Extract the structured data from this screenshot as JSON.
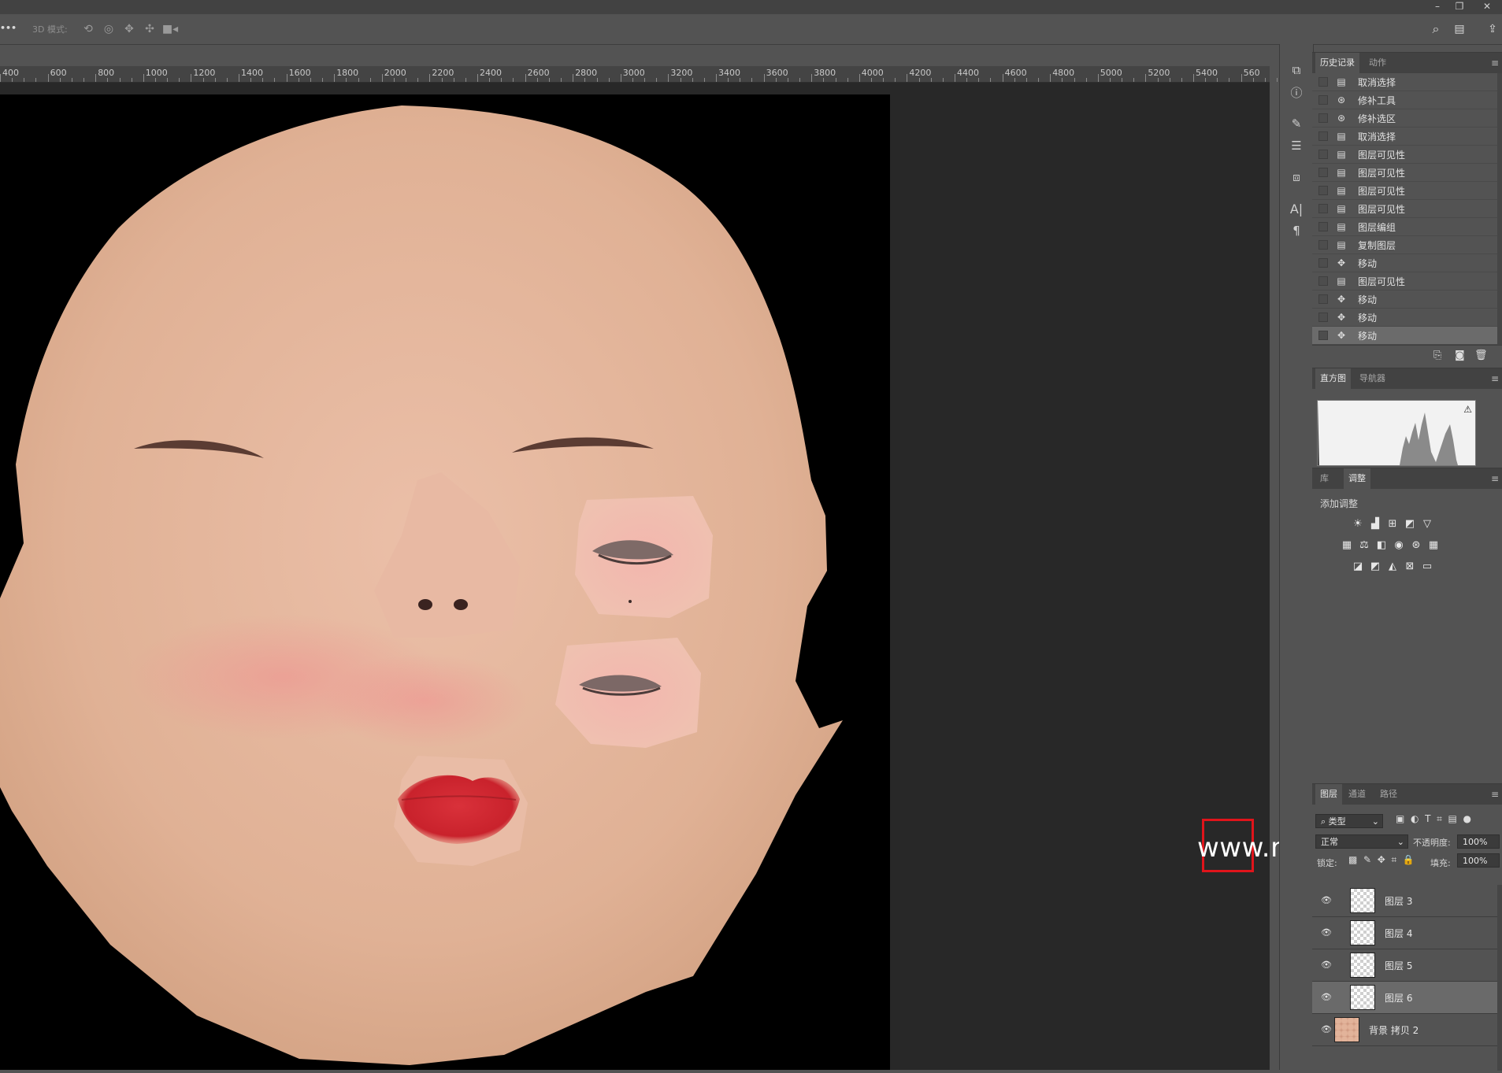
{
  "window": {
    "minimize": "–",
    "restore": "❐",
    "close": "✕"
  },
  "options_bar": {
    "more": "•••",
    "mode_label": "3D 模式:",
    "icons": [
      "rotate-3d-icon",
      "roll-3d-icon",
      "pan-3d-icon",
      "slide-3d-icon",
      "scale-3d-icon"
    ],
    "search_glyph": "⌕",
    "workspace_glyph": "▤",
    "share_glyph": "⇪"
  },
  "ruler": {
    "labels": [
      "400",
      "600",
      "800",
      "1000",
      "1200",
      "1400",
      "1600",
      "1800",
      "2000",
      "2200",
      "2400",
      "2600",
      "2800",
      "3000",
      "3200",
      "3400",
      "3600",
      "3800",
      "4000",
      "4200",
      "4400",
      "4600",
      "4800",
      "5000",
      "5200",
      "5400",
      "560"
    ]
  },
  "collapse_glyph": "‹‹",
  "history_panel": {
    "tabs": [
      "历史记录",
      "动作"
    ],
    "items": [
      {
        "icon": "document-icon",
        "label": "取消选择"
      },
      {
        "icon": "patch-tool-icon",
        "label": "修补工具"
      },
      {
        "icon": "patch-tool-icon",
        "label": "修补选区"
      },
      {
        "icon": "document-icon",
        "label": "取消选择"
      },
      {
        "icon": "document-icon",
        "label": "图层可见性"
      },
      {
        "icon": "document-icon",
        "label": "图层可见性"
      },
      {
        "icon": "document-icon",
        "label": "图层可见性"
      },
      {
        "icon": "document-icon",
        "label": "图层可见性"
      },
      {
        "icon": "document-icon",
        "label": "图层编组"
      },
      {
        "icon": "document-icon",
        "label": "复制图层"
      },
      {
        "icon": "move-icon",
        "label": "移动"
      },
      {
        "icon": "document-icon",
        "label": "图层可见性"
      },
      {
        "icon": "move-icon",
        "label": "移动"
      },
      {
        "icon": "move-icon",
        "label": "移动"
      },
      {
        "icon": "move-icon",
        "label": "移动"
      }
    ],
    "selected_index": 14
  },
  "histogram_panel": {
    "tabs": [
      "直方图",
      "导航器"
    ],
    "warning_glyph": "⚠"
  },
  "adjustments_panel": {
    "tabs": [
      "库",
      "调整"
    ],
    "add_label": "添加调整",
    "row1": [
      "brightness-icon",
      "levels-icon",
      "curves-icon",
      "exposure-icon",
      "vibrance-icon"
    ],
    "row2": [
      "hue-saturation-icon",
      "color-balance-icon",
      "black-white-icon",
      "photo-filter-icon",
      "channel-mixer-icon",
      "color-lookup-icon"
    ],
    "row3": [
      "invert-icon",
      "posterize-icon",
      "threshold-icon",
      "selective-color-icon",
      "gradient-map-icon"
    ]
  },
  "layers_panel": {
    "tabs": [
      "图层",
      "通道",
      "路径"
    ],
    "filter_label": "类型",
    "blend_mode": "正常",
    "opacity_label": "不透明度:",
    "opacity_value": "100%",
    "lock_label": "锁定:",
    "fill_label": "填充:",
    "fill_value": "100%",
    "layers": [
      {
        "name": "图层 3",
        "type": "transparent"
      },
      {
        "name": "图层 4",
        "type": "transparent"
      },
      {
        "name": "图层 5",
        "type": "transparent"
      },
      {
        "name": "图层 6",
        "type": "transparent"
      },
      {
        "name": "背景 拷贝 2",
        "type": "skin"
      }
    ],
    "selected_index": 3
  },
  "watermark": {
    "text": "www.metacosmic.cc"
  },
  "colors": {
    "skin": "#e2b39a",
    "lips": "#cf2b33",
    "panel_bg": "#535353",
    "accent_red": "#e0141b"
  }
}
